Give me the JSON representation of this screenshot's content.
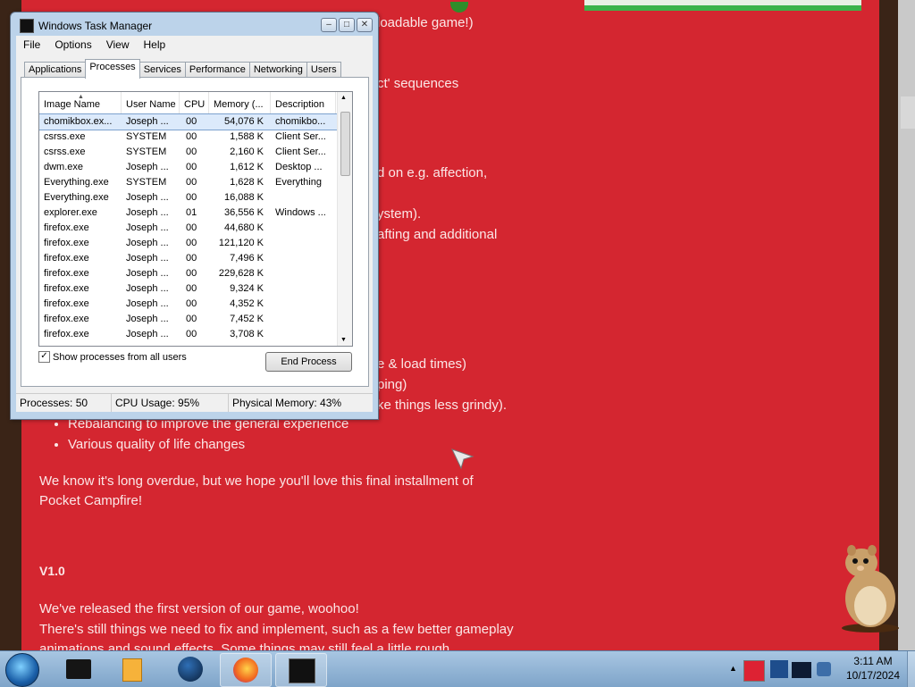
{
  "webpage": {
    "lines": [
      {
        "text": "loadable game!)"
      },
      {
        "text": "ct' sequences"
      },
      {
        "text": "d on e.g. affection,"
      },
      {
        "text": "ystem)."
      },
      {
        "text": "afting and additional"
      },
      {
        "text": "e & load times)"
      },
      {
        "text": "ping)"
      },
      {
        "text": "ke things less grindy)."
      }
    ],
    "bullets": [
      "Rebalancing to improve the general experience",
      "Various quality of life changes"
    ],
    "paragraph1": "We know it's long overdue, but we hope you'll love this final installment of",
    "paragraph1b": "Pocket Campfire!",
    "version_heading": "V1.0",
    "paragraph2": "We've released the first version of our game, woohoo!",
    "paragraph3": "There's still things we need to fix and implement, such as a few better gameplay",
    "paragraph4": "animations and sound effects. Some things may still feel a little rough"
  },
  "taskmanager": {
    "title": "Windows Task Manager",
    "menu": [
      "File",
      "Options",
      "View",
      "Help"
    ],
    "tabs": [
      "Applications",
      "Processes",
      "Services",
      "Performance",
      "Networking",
      "Users"
    ],
    "active_tab": "Processes",
    "columns": [
      "Image Name",
      "User Name",
      "CPU",
      "Memory (...",
      "Description"
    ],
    "rows": [
      {
        "name": "chomikbox.ex...",
        "user": "Joseph ...",
        "cpu": "00",
        "mem": "54,076 K",
        "desc": "chomikbo..."
      },
      {
        "name": "csrss.exe",
        "user": "SYSTEM",
        "cpu": "00",
        "mem": "1,588 K",
        "desc": "Client Ser..."
      },
      {
        "name": "csrss.exe",
        "user": "SYSTEM",
        "cpu": "00",
        "mem": "2,160 K",
        "desc": "Client Ser..."
      },
      {
        "name": "dwm.exe",
        "user": "Joseph ...",
        "cpu": "00",
        "mem": "1,612 K",
        "desc": "Desktop ..."
      },
      {
        "name": "Everything.exe",
        "user": "SYSTEM",
        "cpu": "00",
        "mem": "1,628 K",
        "desc": "Everything"
      },
      {
        "name": "Everything.exe",
        "user": "Joseph ...",
        "cpu": "00",
        "mem": "16,088 K",
        "desc": ""
      },
      {
        "name": "explorer.exe",
        "user": "Joseph ...",
        "cpu": "01",
        "mem": "36,556 K",
        "desc": "Windows ..."
      },
      {
        "name": "firefox.exe",
        "user": "Joseph ...",
        "cpu": "00",
        "mem": "44,680 K",
        "desc": ""
      },
      {
        "name": "firefox.exe",
        "user": "Joseph ...",
        "cpu": "00",
        "mem": "121,120 K",
        "desc": ""
      },
      {
        "name": "firefox.exe",
        "user": "Joseph ...",
        "cpu": "00",
        "mem": "7,496 K",
        "desc": ""
      },
      {
        "name": "firefox.exe",
        "user": "Joseph ...",
        "cpu": "00",
        "mem": "229,628 K",
        "desc": ""
      },
      {
        "name": "firefox.exe",
        "user": "Joseph ...",
        "cpu": "00",
        "mem": "9,324 K",
        "desc": ""
      },
      {
        "name": "firefox.exe",
        "user": "Joseph ...",
        "cpu": "00",
        "mem": "4,352 K",
        "desc": ""
      },
      {
        "name": "firefox.exe",
        "user": "Joseph ...",
        "cpu": "00",
        "mem": "7,452 K",
        "desc": ""
      },
      {
        "name": "firefox.exe",
        "user": "Joseph ...",
        "cpu": "00",
        "mem": "3,708 K",
        "desc": ""
      }
    ],
    "show_all_label": "Show processes from all users",
    "show_all_checked": "✓",
    "end_process_label": "End Process",
    "status": {
      "processes": "Processes: 50",
      "cpu": "CPU Usage: 95%",
      "memory": "Physical Memory: 43%"
    }
  },
  "taskbar": {
    "time": "3:11 AM",
    "date": "10/17/2024",
    "icons": [
      "black-app-icon",
      "media-player-icon",
      "globe-app-icon",
      "firefox-icon",
      "task-manager-icon"
    ]
  }
}
